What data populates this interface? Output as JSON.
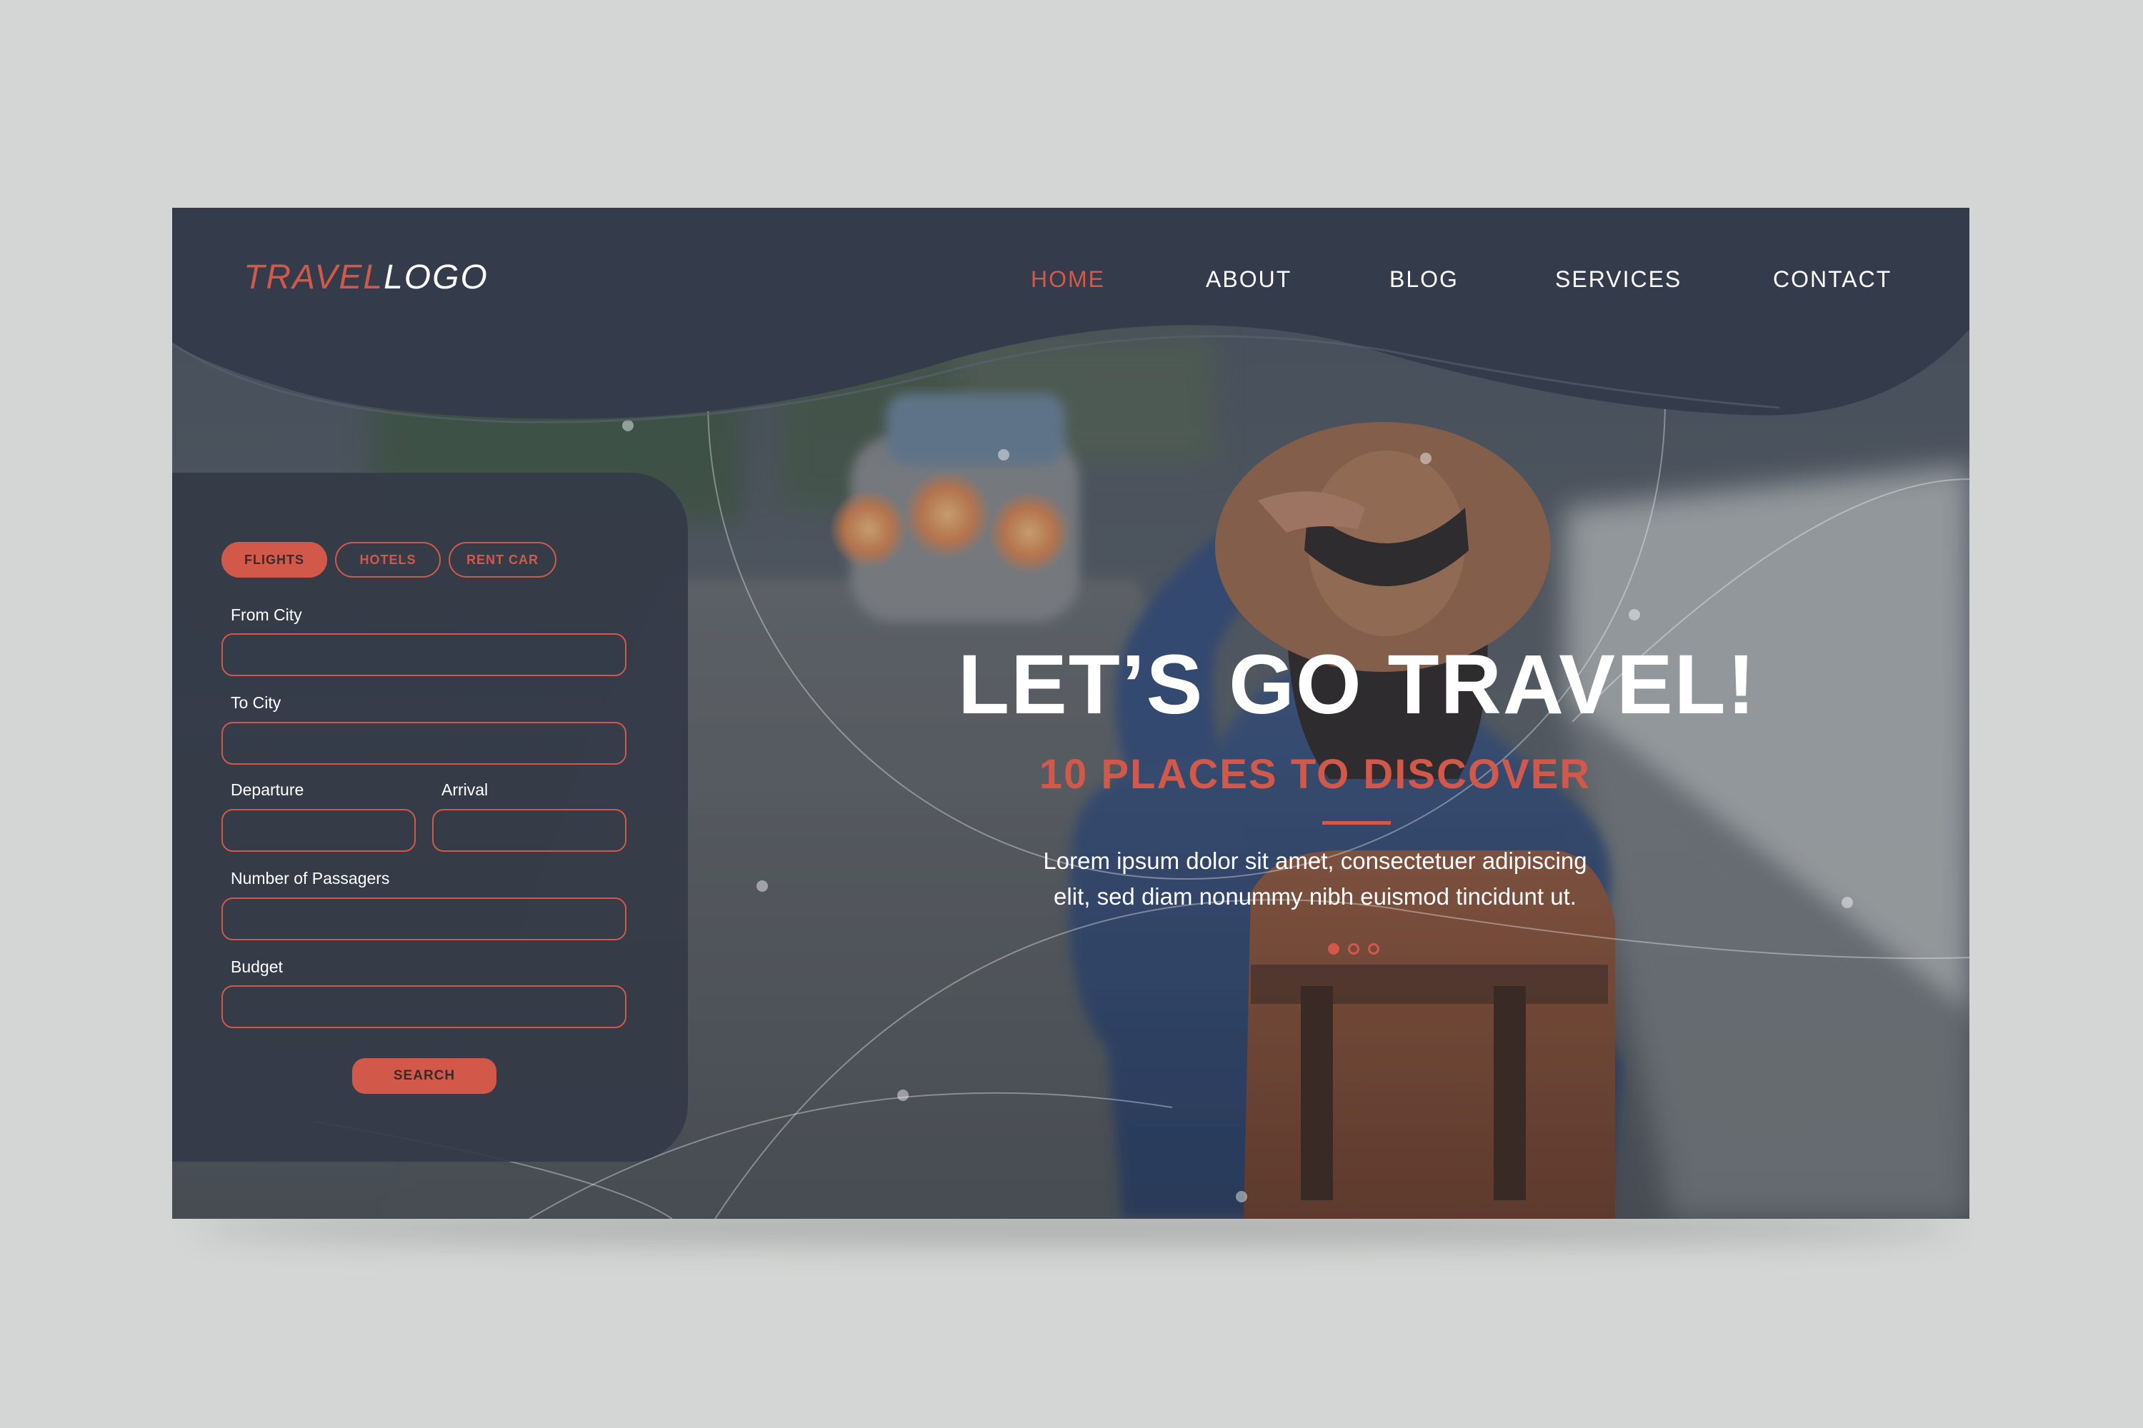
{
  "logo": {
    "part1": "TRAVEL",
    "part2": "LOGO"
  },
  "nav": {
    "items": [
      {
        "label": "HOME",
        "active": true
      },
      {
        "label": "ABOUT"
      },
      {
        "label": "BLOG"
      },
      {
        "label": "SERVICES"
      },
      {
        "label": "CONTACT"
      }
    ]
  },
  "search_panel": {
    "tabs": [
      {
        "label": "FLIGHTS",
        "active": true
      },
      {
        "label": "HOTELS"
      },
      {
        "label": "RENT CAR"
      }
    ],
    "fields": {
      "from_city": {
        "label": "From City",
        "value": "",
        "placeholder": ""
      },
      "to_city": {
        "label": "To City",
        "value": "",
        "placeholder": ""
      },
      "departure": {
        "label": "Departure",
        "value": "",
        "placeholder": ""
      },
      "arrival": {
        "label": "Arrival",
        "value": "",
        "placeholder": ""
      },
      "passengers": {
        "label": "Number of Passagers",
        "value": "",
        "placeholder": ""
      },
      "budget": {
        "label": "Budget",
        "value": "",
        "placeholder": ""
      }
    },
    "search_label": "SEARCH"
  },
  "hero": {
    "title": "LET’S GO TRAVEL!",
    "subtitle": "10 PLACES TO DISCOVER",
    "description_line1": "Lorem ipsum dolor sit amet, consectetuer adipiscing",
    "description_line2": "elit, sed diam nonummy nibh euismod tincidunt ut.",
    "carousel": {
      "count": 3,
      "active_index": 0
    }
  },
  "colors": {
    "accent": "#d2594a",
    "header": "#343b4a",
    "panel": "#343a47",
    "page_bg": "#d4d6d5",
    "text_light": "#ffffff"
  },
  "icons": {
    "hero_image": "traveler-with-hat-and-backpack-photo",
    "carousel_dot": "circle-dot"
  }
}
